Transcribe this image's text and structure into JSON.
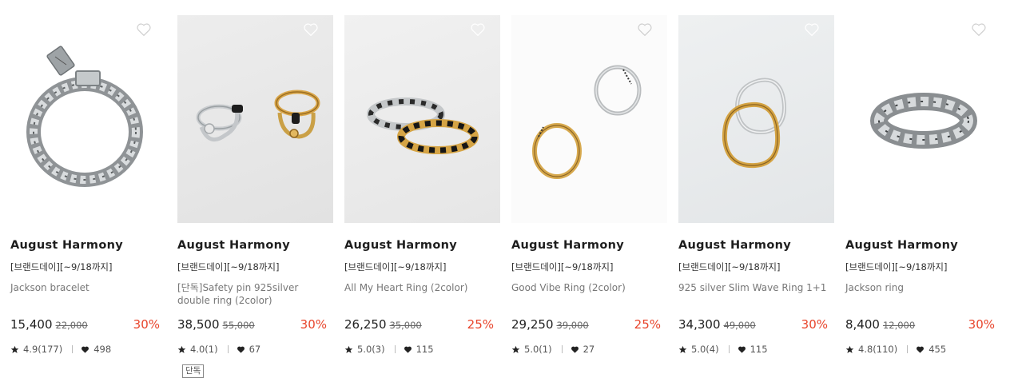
{
  "colors": {
    "discount": "#e8452c",
    "brand_text": "#1e1e1e",
    "name_text": "#777777"
  },
  "products": [
    {
      "brand": "August Harmony",
      "promo": "[브랜드데이][~9/18까지]",
      "name": "Jackson bracelet",
      "price": "15,400",
      "original_price": "22,000",
      "discount": "30%",
      "rating": "4.9(177)",
      "likes": "498",
      "badge": null,
      "image_icon": "chain-bracelet-icon"
    },
    {
      "brand": "August Harmony",
      "promo": "[브랜드데이][~9/18까지]",
      "name": "[단독]Safety pin 925silver double ring (2color)",
      "price": "38,500",
      "original_price": "55,000",
      "discount": "30%",
      "rating": "4.0(1)",
      "likes": "67",
      "badge": "단독",
      "image_icon": "safety-pin-ring-icon"
    },
    {
      "brand": "August Harmony",
      "promo": "[브랜드데이][~9/18까지]",
      "name": "All My Heart Ring (2color)",
      "price": "26,250",
      "original_price": "35,000",
      "discount": "25%",
      "rating": "5.0(3)",
      "likes": "115",
      "badge": null,
      "image_icon": "heart-ring-icon"
    },
    {
      "brand": "August Harmony",
      "promo": "[브랜드데이][~9/18까지]",
      "name": "Good Vibe Ring (2color)",
      "price": "29,250",
      "original_price": "39,000",
      "discount": "25%",
      "rating": "5.0(1)",
      "likes": "27",
      "badge": null,
      "image_icon": "band-ring-icon"
    },
    {
      "brand": "August Harmony",
      "promo": "[브랜드데이][~9/18까지]",
      "name": "925 silver Slim Wave Ring 1+1",
      "price": "34,300",
      "original_price": "49,000",
      "discount": "30%",
      "rating": "5.0(4)",
      "likes": "115",
      "badge": null,
      "image_icon": "wave-ring-icon"
    },
    {
      "brand": "August Harmony",
      "promo": "[브랜드데이][~9/18까지]",
      "name": "Jackson ring",
      "price": "8,400",
      "original_price": "12,000",
      "discount": "30%",
      "rating": "4.8(110)",
      "likes": "455",
      "badge": null,
      "image_icon": "chain-ring-icon"
    }
  ]
}
